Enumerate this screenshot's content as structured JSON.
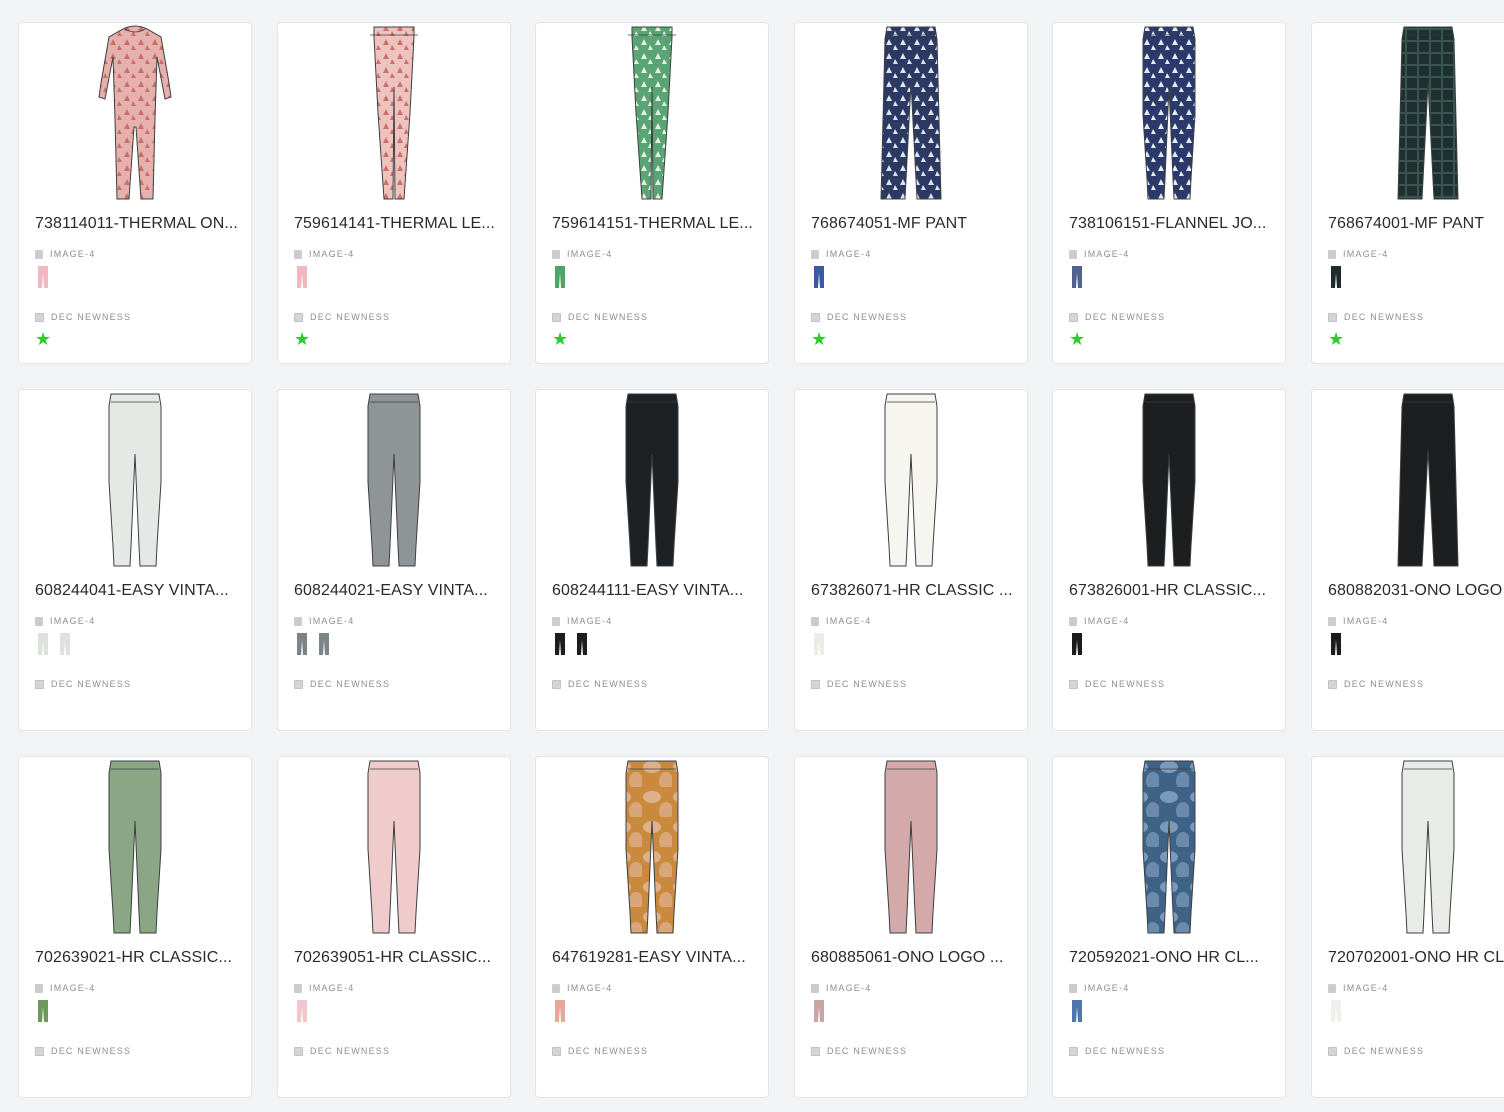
{
  "cards": [
    {
      "title": "738114011-THERMAL ON...",
      "image_label": "IMAGE-4",
      "tag": "DEC NEWNESS",
      "starred": true,
      "garment": "onesie",
      "color": "#e6b0ad",
      "accent": "#c86f6a",
      "pattern": "print",
      "swatch_colors": [
        "#f0b8c0"
      ]
    },
    {
      "title": "759614141-THERMAL LE...",
      "image_label": "IMAGE-4",
      "tag": "DEC NEWNESS",
      "starred": true,
      "garment": "legging",
      "color": "#eec2be",
      "accent": "#c9716b",
      "pattern": "print",
      "swatch_colors": [
        "#f2b8c2"
      ]
    },
    {
      "title": "759614151-THERMAL LE...",
      "image_label": "IMAGE-4",
      "tag": "DEC NEWNESS",
      "starred": true,
      "garment": "legging",
      "color": "#5aa473",
      "accent": "#dff0e4",
      "pattern": "print",
      "swatch_colors": [
        "#4fa366"
      ]
    },
    {
      "title": "768674051-MF PANT",
      "image_label": "IMAGE-4",
      "tag": "DEC NEWNESS",
      "starred": true,
      "garment": "pant",
      "color": "#2c3a63",
      "accent": "#dfe3ee",
      "pattern": "print",
      "swatch_colors": [
        "#3a5aa8"
      ]
    },
    {
      "title": "738106151-FLANNEL JO...",
      "image_label": "IMAGE-4",
      "tag": "DEC NEWNESS",
      "starred": true,
      "garment": "jogger",
      "color": "#2b3a6a",
      "accent": "#e6e9f2",
      "pattern": "print",
      "swatch_colors": [
        "#51628f"
      ]
    },
    {
      "title": "768674001-MF PANT",
      "image_label": "IMAGE-4",
      "tag": "DEC NEWNESS",
      "starred": true,
      "garment": "pant",
      "color": "#1f3030",
      "accent": "#3a5450",
      "pattern": "plaid",
      "swatch_colors": [
        "#1d2b2a"
      ]
    },
    {
      "title": "608244041-EASY VINTA...",
      "image_label": "IMAGE-4",
      "tag": "DEC NEWNESS",
      "starred": false,
      "garment": "jogger",
      "color": "#e5e9e5",
      "accent": "#c5cbc5",
      "pattern": "solid",
      "swatch_colors": [
        "#dde2dd",
        "#dde2dd"
      ]
    },
    {
      "title": "608244021-EASY VINTA...",
      "image_label": "IMAGE-4",
      "tag": "DEC NEWNESS",
      "starred": false,
      "garment": "jogger",
      "color": "#8f9497",
      "accent": "#7a7f82",
      "pattern": "solid",
      "swatch_colors": [
        "#7d8488",
        "#7d8488"
      ]
    },
    {
      "title": "608244111-EASY VINTA...",
      "image_label": "IMAGE-4",
      "tag": "DEC NEWNESS",
      "starred": false,
      "garment": "jogger",
      "color": "#1e2124",
      "accent": "#3a3d40",
      "pattern": "solid",
      "swatch_colors": [
        "#1b1d1f",
        "#1b1d1f"
      ]
    },
    {
      "title": "673826071-HR CLASSIC ...",
      "image_label": "IMAGE-4",
      "tag": "DEC NEWNESS",
      "starred": false,
      "garment": "jogger",
      "color": "#f6f5ef",
      "accent": "#d9d8d0",
      "pattern": "solid",
      "swatch_colors": [
        "#ecece6"
      ]
    },
    {
      "title": "673826001-HR CLASSIC...",
      "image_label": "IMAGE-4",
      "tag": "DEC NEWNESS",
      "starred": false,
      "garment": "jogger",
      "color": "#1c1e20",
      "accent": "#36393c",
      "pattern": "solid",
      "swatch_colors": [
        "#1a1c1e"
      ]
    },
    {
      "title": "680882031-ONO LOGO",
      "image_label": "IMAGE-4",
      "tag": "DEC NEWNESS",
      "starred": false,
      "garment": "pant",
      "color": "#1c1e20",
      "accent": "#36393c",
      "pattern": "solid",
      "swatch_colors": [
        "#1a1c1e"
      ]
    },
    {
      "title": "702639021-HR CLASSIC...",
      "image_label": "IMAGE-4",
      "tag": "DEC NEWNESS",
      "starred": false,
      "garment": "jogger",
      "color": "#8aa684",
      "accent": "#6f8c69",
      "pattern": "solid",
      "swatch_colors": [
        "#6f9a5e"
      ]
    },
    {
      "title": "702639051-HR CLASSIC...",
      "image_label": "IMAGE-4",
      "tag": "DEC NEWNESS",
      "starred": false,
      "garment": "jogger",
      "color": "#efcbcb",
      "accent": "#d8aeae",
      "pattern": "solid",
      "swatch_colors": [
        "#f0c8cc"
      ]
    },
    {
      "title": "647619281-EASY VINTA...",
      "image_label": "IMAGE-4",
      "tag": "DEC NEWNESS",
      "starred": false,
      "garment": "jogger",
      "color": "#c98a3e",
      "accent": "#e2b9a0",
      "pattern": "tiedye",
      "swatch_colors": [
        "#e8a79a"
      ]
    },
    {
      "title": "680885061-ONO LOGO ...",
      "image_label": "IMAGE-4",
      "tag": "DEC NEWNESS",
      "starred": false,
      "garment": "jogger",
      "color": "#d3a9aa",
      "accent": "#b88e8f",
      "pattern": "solid",
      "swatch_colors": [
        "#c9a6a4"
      ]
    },
    {
      "title": "720592021-ONO HR CL...",
      "image_label": "IMAGE-4",
      "tag": "DEC NEWNESS",
      "starred": false,
      "garment": "jogger",
      "color": "#3f6287",
      "accent": "#8aa6c4",
      "pattern": "tiedye",
      "swatch_colors": [
        "#4f77ad"
      ]
    },
    {
      "title": "720702001-ONO HR CL",
      "image_label": "IMAGE-4",
      "tag": "DEC NEWNESS",
      "starred": false,
      "garment": "jogger",
      "color": "#e8ebe6",
      "accent": "#c7ccc5",
      "pattern": "solid",
      "swatch_colors": [
        "#eef0ec"
      ]
    }
  ],
  "star_color": "#2ecc2e",
  "star_glyph": "★"
}
